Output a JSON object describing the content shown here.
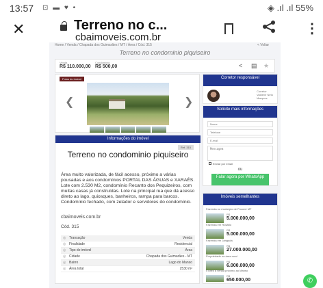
{
  "status": {
    "time": "13:57",
    "icons": "⊡ ▬ ♥ •",
    "right": "◈ .ıl .ıl 55%"
  },
  "browser": {
    "close": "✕",
    "title": "Terreno no c...",
    "url": "cbaimoveis.com.br",
    "share": "<",
    "menu": "⋮"
  },
  "page": {
    "breadcrumb": "Home / Venda / Chapada dos Guimarães / MT / Área / Cód. 315",
    "back": "< Voltar",
    "heading": "Terreno no condominio piquiseiro",
    "price_label_1": "Venda",
    "price_1": "R$ 110.000,00",
    "price_label_2": "Condomínio",
    "price_2": "R$ 500,00",
    "gallery_tag": "Fotos do imóvel",
    "info_header": "Informações do imóvel",
    "ref": "Ref. 315",
    "title": "Terreno no condominio piquiseiro",
    "description": "Área muito valorizada, de fácil acesso, próximo a várias pousadas e aos condomínios PORTAL DAS ÁGUAS e XARAÉS. Lote com 2.530 M2, condomínio Recanto dos Pequizeiros, com muitas casas já construídas. Lote na principal rua que dá acesso direto ao lago, quiosques, banheiros, rampa para barcos. Condomínio fechado, com zelador e servidores do condomínio.",
    "site": "cbaimoveis.com.br",
    "code": "Cód. 315",
    "table": [
      {
        "k": "Transação",
        "v": "Venda"
      },
      {
        "k": "Finalidade",
        "v": "Residencial"
      },
      {
        "k": "Tipo de imóvel",
        "v": "Área"
      },
      {
        "k": "Cidade",
        "v": "Chapada dos Guimarães - MT"
      },
      {
        "k": "Bairro",
        "v": "Lago do Manso"
      },
      {
        "k": "Área total",
        "v": "2530 m²"
      }
    ]
  },
  "sidebar": {
    "corretor_header": "Corretor responsável",
    "corretor_name": "Corretor Valdenir Neto Marques",
    "form_header": "Solicite mais informações",
    "ph_name": "Nome",
    "ph_phone": "Telefone",
    "ph_email": "E-mail",
    "ph_msg": "Mensagem",
    "check_label": "Enviar por email",
    "ou": "ou",
    "wa_button": "Falar agora por WhatsApp",
    "similar_header": "Imóveis semelhantes",
    "similar": [
      {
        "cap": "Fazenda no município de Poconé MT",
        "sm": "R$",
        "price": "5.000.000,00"
      },
      {
        "cap": "Fazenda em Rosário",
        "sm": "R$",
        "price": "5.000.000,00"
      },
      {
        "cap": "Fazenda em Jangada",
        "sm": "R$",
        "price": "27.000.000,00"
      },
      {
        "cap": "Propriedade na área rural",
        "sm": "R$",
        "price": "6.000.000,00"
      },
      {
        "cap": "5 lotes à venda próximo ao Manso",
        "sm": "R$",
        "price": "650.000,00"
      }
    ]
  },
  "colors": {
    "brand_blue": "#20358f",
    "whatsapp": "#47c46b",
    "gallery_tag": "#6b2020"
  },
  "icons": {
    "whatsapp_fab": "whatsapp-icon"
  }
}
